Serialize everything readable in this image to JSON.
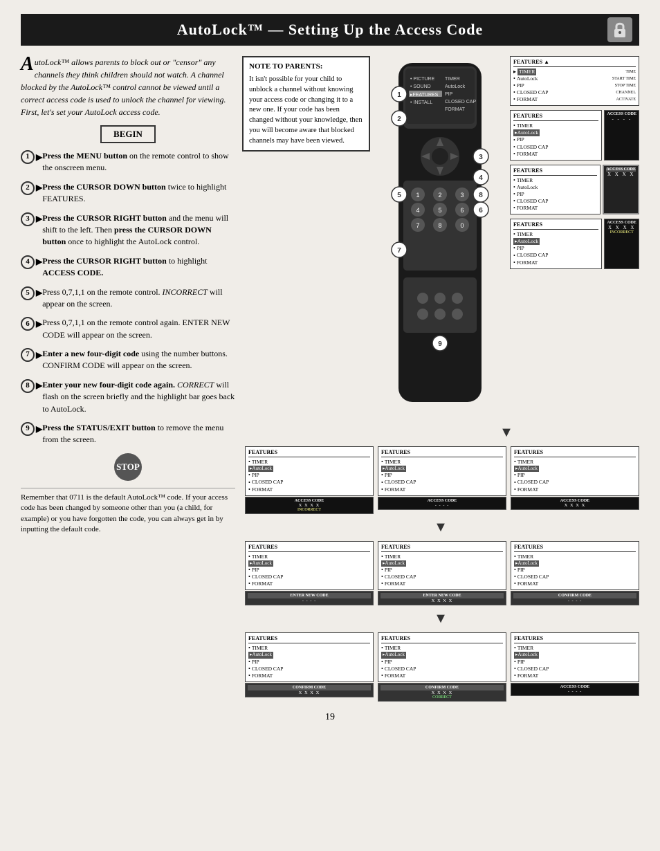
{
  "header": {
    "title": "AutoLock™ — Setting Up the Access Code"
  },
  "intro": {
    "text": "utoLock™ allows parents to block out or \"censor\" any channels they think children should not watch. A channel blocked by the AutoLock™ control cannot be viewed until a correct access code is used to unlock the channel for viewing. First, let's set your AutoLock access code.",
    "drop_cap": "A",
    "begin_label": "BEGIN"
  },
  "steps": [
    {
      "num": "1",
      "text": "Press the MENU button on the remote control to show the onscreen menu."
    },
    {
      "num": "2",
      "text": "Press the CURSOR DOWN button twice to highlight FEATURES."
    },
    {
      "num": "3",
      "text": "Press the CURSOR RIGHT button and the menu will shift to the left. Then press the CURSOR DOWN button once to highlight the AutoLock control."
    },
    {
      "num": "4",
      "text": "Press the CURSOR RIGHT button to highlight ACCESS CODE."
    },
    {
      "num": "5",
      "text": "Press 0,7,1,1 on the remote control. INCORRECT will appear on the screen."
    },
    {
      "num": "6",
      "text": "Press 0,7,1,1 on the remote control again. ENTER NEW CODE will appear on the screen."
    },
    {
      "num": "7",
      "text": "Enter a new four-digit code using the number buttons. CONFIRM CODE will appear on the screen."
    },
    {
      "num": "8",
      "text": "Enter your new four-digit code again. CORRECT will flash on the screen briefly and the highlight bar goes back to AutoLock."
    },
    {
      "num": "9",
      "text": "Press the STATUS/EXIT button to remove the menu from the screen."
    }
  ],
  "stop_label": "STOP",
  "footer_note": "Remember that 0711 is the default AutoLock™ code. If your access code has been changed by someone other than you (a child, for example) or you have forgotten the code, you can always get in by inputting the default code.",
  "note_to_parents": {
    "title": "NOTE TO PARENTS:",
    "text": "It isn't possible for your child to unblock a channel without knowing your access code or changing it to a new one. If your code has been changed without your knowledge, then you will become aware that blocked channels may have been viewed."
  },
  "panels": {
    "row1": {
      "label": "FEATURES",
      "items": [
        "TIMER",
        "AutoLock",
        "PIP",
        "CLOSED CAP",
        "FORMAT"
      ],
      "highlighted_item": "FEATURES",
      "right_panel": {
        "label": "FEATURES",
        "items": [
          "TIMER",
          "AutoLock",
          "PIP",
          "CLOSED CAP",
          "FORMAT"
        ],
        "right_labels": [
          "TIME",
          "START TIME",
          "STOP TIME",
          "CHANNEL",
          "ACTIVATE"
        ],
        "highlighted": "TIMER"
      }
    },
    "row2": {
      "label": "FEATURES",
      "items": [
        "TIMER",
        "AutoLock",
        "PIP",
        "CLOSED CAP",
        "FORMAT"
      ],
      "highlighted": "AutoLock",
      "code_label": "ACCESS CODE",
      "code_value": "- - - -"
    },
    "row3_left": {
      "label": "FEATURES",
      "items": [
        "TIMER",
        "AutoLock",
        "PIP",
        "CLOSED CAP",
        "FORMAT"
      ],
      "highlighted": "AutoLock",
      "code_label": "ACCESS CODE",
      "code_value": "X X X X",
      "code2": "INCORRECT"
    },
    "row3_mid": {
      "label": "FEATURES",
      "items": [
        "TIMER",
        "AutoLock",
        "PIP",
        "CLOSED CAP",
        "FORMAT"
      ],
      "code_label": "ACCESS CODE",
      "code_value": "- - - -"
    },
    "row3_right": {
      "label": "FEATURES",
      "items": [
        "TIMER",
        "AutoLock",
        "PIP",
        "CLOSED CAP",
        "FORMAT"
      ],
      "code_label": "ACCESS CODE",
      "code_value": "X X X X"
    },
    "row4_left": {
      "label": "FEATURES",
      "items": [
        "TIMER",
        "AutoLock",
        "PIP",
        "CLOSED CAP",
        "FORMAT"
      ],
      "code_label": "ENTER NEW CODE",
      "code_value": "- - - -"
    },
    "row4_mid": {
      "label": "FEATURES",
      "items": [
        "TIMER",
        "AutoLock",
        "PIP",
        "CLOSED CAP",
        "FORMAT"
      ],
      "code_label": "ENTER NEW CODE",
      "code_value": "X X X X"
    },
    "row4_right": {
      "label": "FEATURES",
      "items": [
        "TIMER",
        "AutoLock",
        "PIP",
        "CLOSED CAP",
        "FORMAT"
      ],
      "code_label": "CONFIRM CODE",
      "code_value": "- - - -"
    },
    "row5_left": {
      "label": "FEATURES",
      "items": [
        "TIMER",
        "AutoLock",
        "PIP",
        "CLOSED CAP",
        "FORMAT"
      ],
      "code_label": "CONFIRM CODE",
      "code_value": "X X X X"
    },
    "row5_mid": {
      "label": "FEATURES",
      "items": [
        "TIMER",
        "AutoLock",
        "PIP",
        "CLOSED CAP",
        "FORMAT"
      ],
      "code_label": "CONFIRM CODE",
      "code_value": "X X X X",
      "code2": "CORRECT"
    },
    "row5_right": {
      "label": "FEATURES",
      "items": [
        "TIMER",
        "AutoLock",
        "PIP",
        "CLOSED CAP",
        "FORMAT"
      ],
      "code_label": "ACCESS CODE",
      "code_value": "- - - -",
      "highlighted": "AutoLock"
    }
  },
  "page_number": "19",
  "remote": {
    "step_badges": [
      "1",
      "2",
      "3",
      "4",
      "5",
      "6",
      "7",
      "8",
      "9"
    ]
  }
}
